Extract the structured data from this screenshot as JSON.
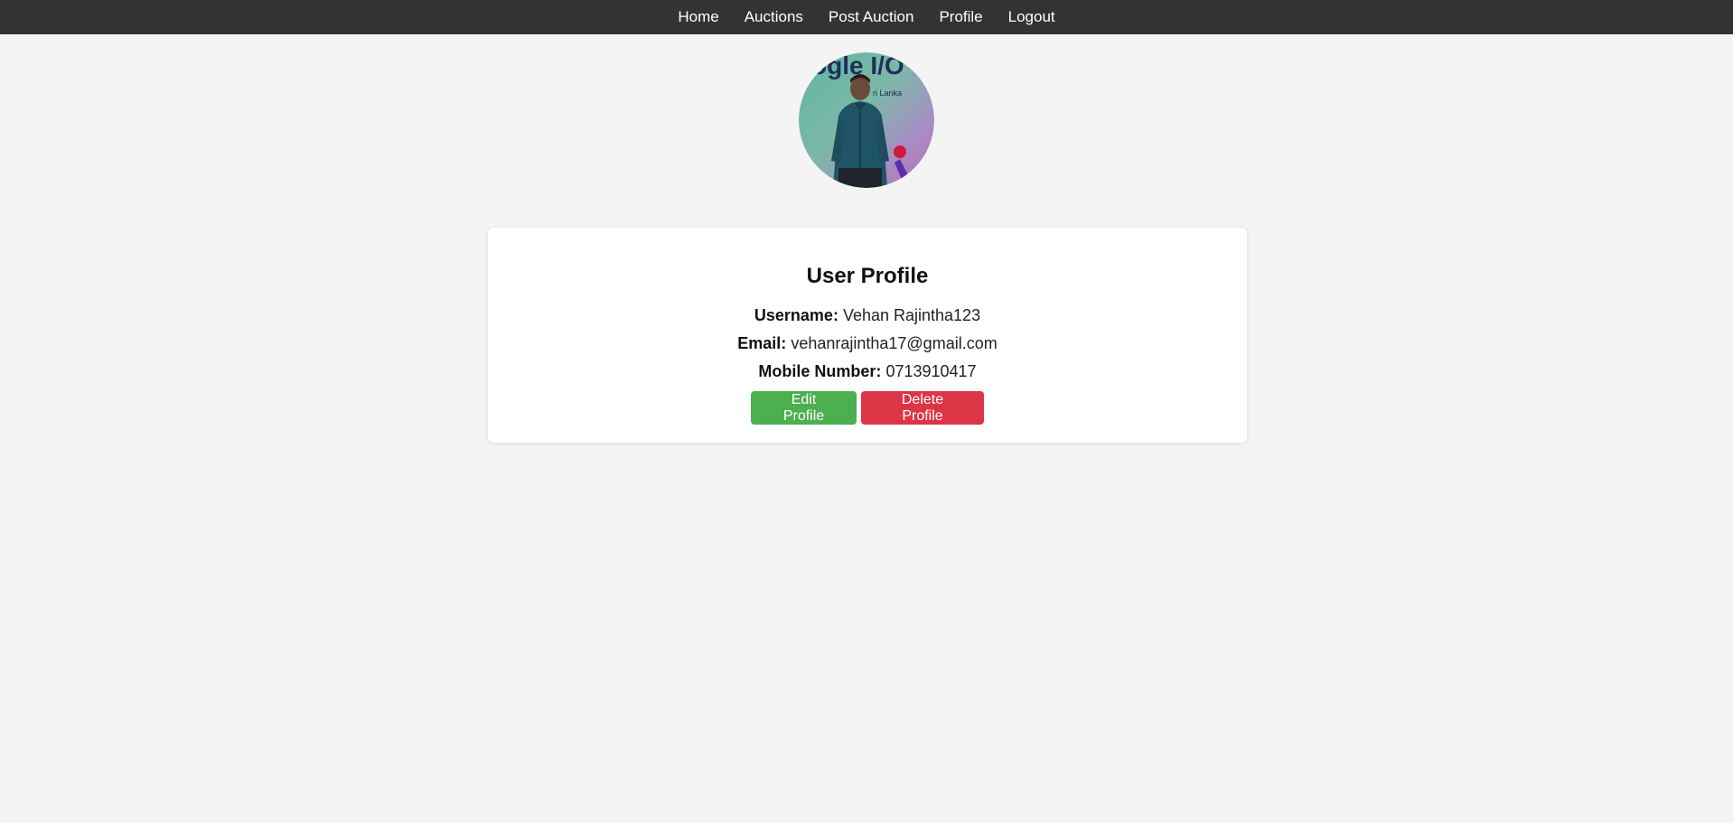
{
  "nav": {
    "items": [
      "Home",
      "Auctions",
      "Post Auction",
      "Profile",
      "Logout"
    ]
  },
  "avatar": {
    "photo_text": "ogle I/O",
    "photo_subtext": "ri Lanka"
  },
  "profile": {
    "title": "User Profile",
    "username_label": "Username:",
    "username": "Vehan Rajintha123",
    "email_label": "Email:",
    "email": "vehanrajintha17@gmail.com",
    "mobile_label": "Mobile Number:",
    "mobile": "0713910417"
  },
  "actions": {
    "edit_label": "Edit Profile",
    "delete_label": "Delete Profile"
  },
  "colors": {
    "navbar": "#333333",
    "background": "#f4f4f4",
    "edit": "#4caf50",
    "delete": "#dc3545"
  }
}
